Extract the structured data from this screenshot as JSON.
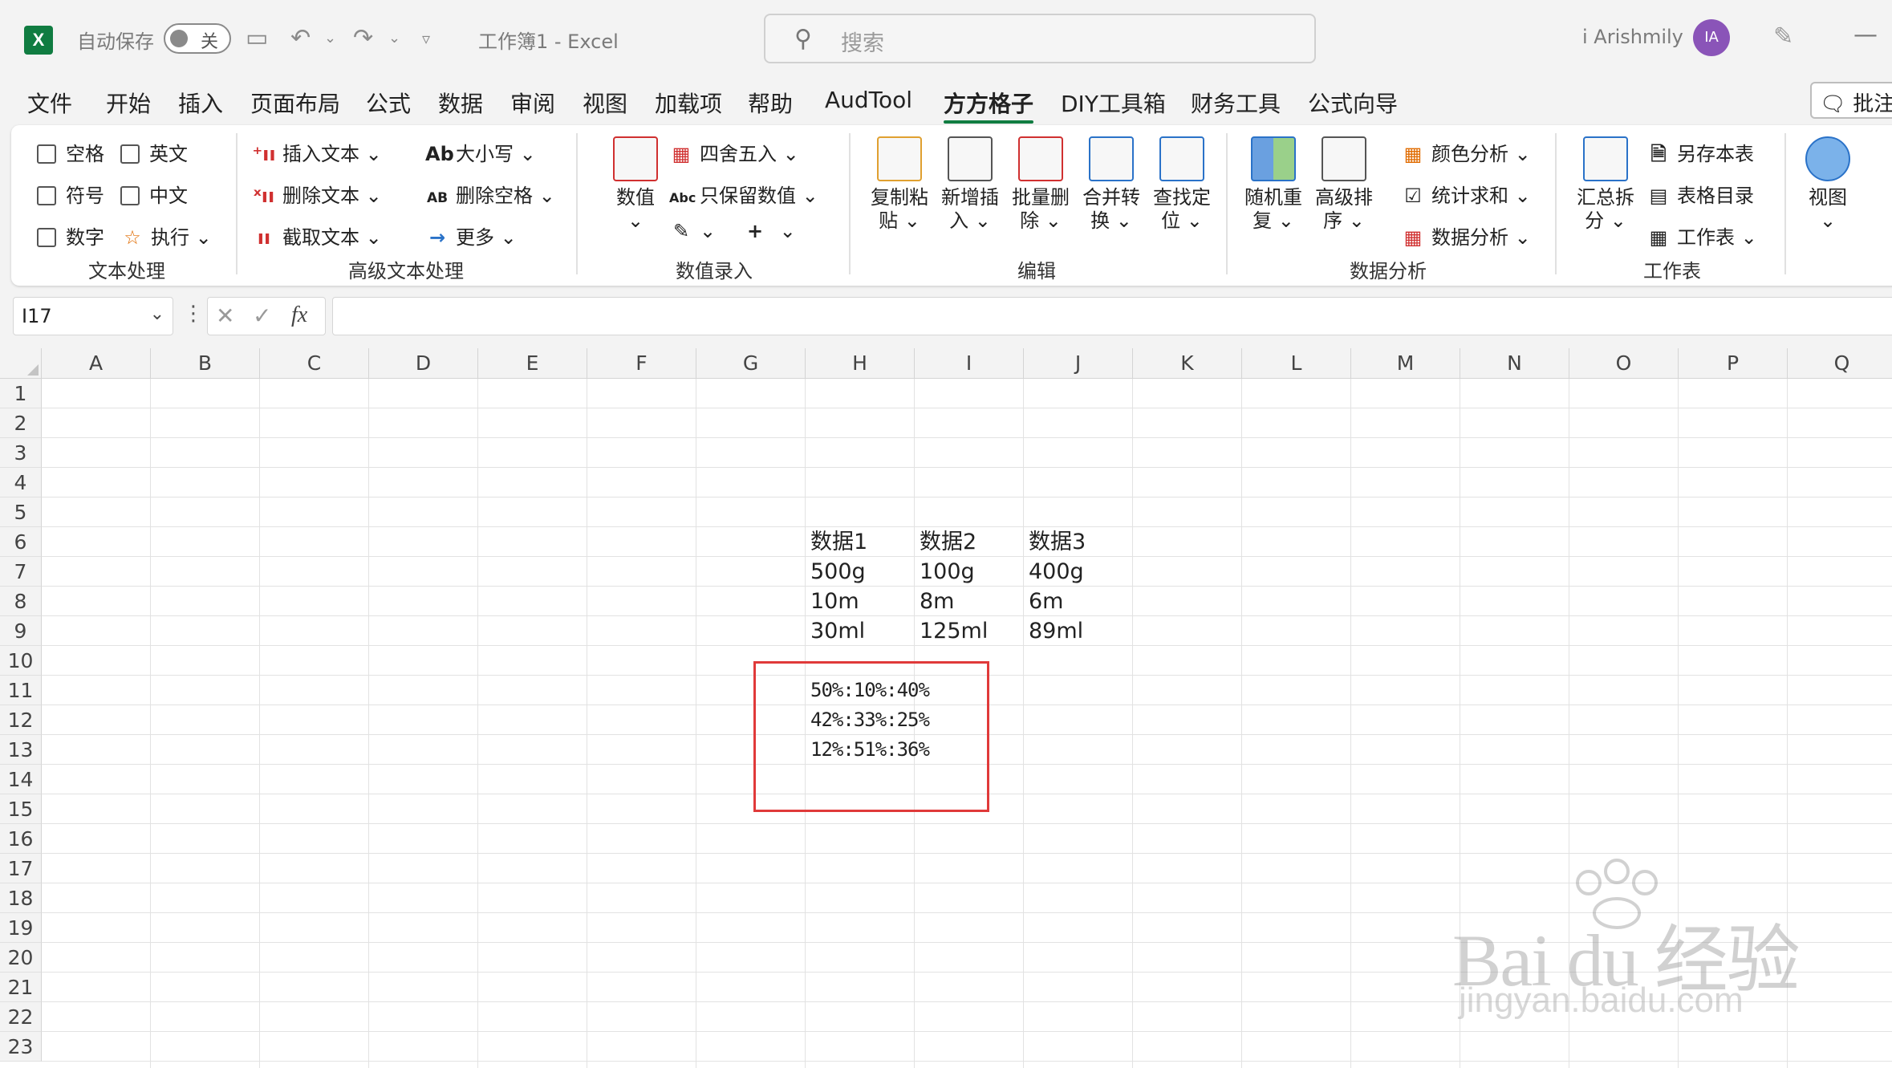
{
  "titlebar": {
    "autosave_label": "自动保存",
    "toggle_label": "关",
    "doc_title": "工作簿1  -  Excel",
    "search_placeholder": "搜索",
    "username": "i Arishmily",
    "avatar_initials": "IA"
  },
  "menu": {
    "items": [
      "文件",
      "开始",
      "插入",
      "页面布局",
      "公式",
      "数据",
      "审阅",
      "视图",
      "加载项",
      "帮助",
      "AudTool",
      "方方格子",
      "DIY工具箱",
      "财务工具",
      "公式向导"
    ],
    "active": "方方格子",
    "comment_button": "批注"
  },
  "ribbon": {
    "text_group": {
      "label": "文本处理",
      "items": [
        "空格",
        "英文",
        "符号",
        "中文",
        "数字"
      ],
      "execute": "执行"
    },
    "advanced_text_group": {
      "label": "高级文本处理",
      "insert_text": "插入文本",
      "delete_text": "删除文本",
      "cut_text": "截取文本",
      "case": "大小写",
      "delete_space": "删除空格",
      "more": "更多",
      "ab_icon": "Ab",
      "ab_small_icon": "AB"
    },
    "number_group": {
      "label": "数值录入",
      "number": "数值",
      "round": "四舍五入",
      "keep_number": "只保留数值",
      "abc_icon": "Abc"
    },
    "edit_group": {
      "label": "编辑",
      "copy_paste": [
        "复制粘",
        "贴"
      ],
      "insert_new": [
        "新增插",
        "入"
      ],
      "batch_delete": [
        "批量删",
        "除"
      ],
      "merge_convert": [
        "合并转",
        "换"
      ],
      "find_locate": [
        "查找定",
        "位"
      ]
    },
    "analysis_group": {
      "label": "数据分析",
      "random_repeat": [
        "随机重",
        "复"
      ],
      "advanced_sort": [
        "高级排",
        "序"
      ],
      "color_analysis": "颜色分析",
      "stat_sum": "统计求和",
      "data_analysis": "数据分析"
    },
    "sheet_group": {
      "label": "工作表",
      "summary_split": [
        "汇总拆",
        "分"
      ],
      "save_sheet": "另存本表",
      "table_catalog": "表格目录",
      "worksheet": "工作表"
    },
    "view_group": {
      "view": "视图"
    }
  },
  "formula_bar": {
    "name_box": "I17",
    "fx": "fx",
    "formula": ""
  },
  "sheet": {
    "columns": [
      "A",
      "B",
      "C",
      "D",
      "E",
      "F",
      "G",
      "H",
      "I",
      "J",
      "K",
      "L",
      "M",
      "N",
      "O",
      "P",
      "Q"
    ],
    "rows": [
      "1",
      "2",
      "3",
      "4",
      "5",
      "6",
      "7",
      "8",
      "9",
      "10",
      "11",
      "12",
      "13",
      "14",
      "15",
      "16",
      "17",
      "18",
      "19",
      "20",
      "21",
      "22",
      "23"
    ],
    "cells": [
      {
        "col": 7,
        "row": 5,
        "value": "数据1"
      },
      {
        "col": 8,
        "row": 5,
        "value": "数据2"
      },
      {
        "col": 9,
        "row": 5,
        "value": "数据3"
      },
      {
        "col": 7,
        "row": 6,
        "value": "500g"
      },
      {
        "col": 8,
        "row": 6,
        "value": "100g"
      },
      {
        "col": 9,
        "row": 6,
        "value": "400g"
      },
      {
        "col": 7,
        "row": 7,
        "value": "10m"
      },
      {
        "col": 8,
        "row": 7,
        "value": "8m"
      },
      {
        "col": 9,
        "row": 7,
        "value": "6m"
      },
      {
        "col": 7,
        "row": 8,
        "value": "30ml"
      },
      {
        "col": 8,
        "row": 8,
        "value": "125ml"
      },
      {
        "col": 9,
        "row": 8,
        "value": "89ml"
      },
      {
        "col": 7,
        "row": 10,
        "value": "50%:10%:40%",
        "narrow": true
      },
      {
        "col": 7,
        "row": 11,
        "value": "42%:33%:25%",
        "narrow": true
      },
      {
        "col": 7,
        "row": 12,
        "value": "12%:51%:36%",
        "narrow": true
      }
    ],
    "highlight_color": "#e03a3a"
  },
  "watermark": {
    "brand": "Bai du 经验",
    "url": "jingyan.baidu.com"
  },
  "colors": {
    "excel_green": "#107c41",
    "avatar": "#8a54b8"
  }
}
